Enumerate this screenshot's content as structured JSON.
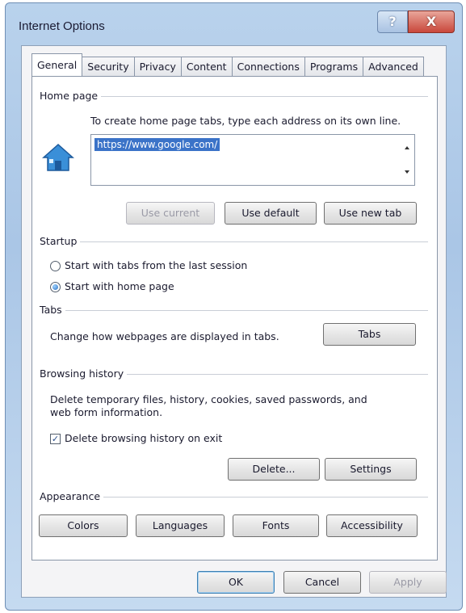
{
  "window": {
    "title": "Internet Options",
    "help_glyph": "?",
    "close_glyph": "X"
  },
  "tabs": [
    "General",
    "Security",
    "Privacy",
    "Content",
    "Connections",
    "Programs",
    "Advanced"
  ],
  "home_page": {
    "group_label": "Home page",
    "instruction": "To create home page tabs, type each address on its own line.",
    "address_value": "https://www.google.com/",
    "buttons": {
      "use_current": "Use current",
      "use_default": "Use default",
      "use_new_tab": "Use new tab"
    }
  },
  "startup": {
    "group_label": "Startup",
    "options": [
      {
        "label": "Start with tabs from the last session",
        "checked": false
      },
      {
        "label": "Start with home page",
        "checked": true
      }
    ]
  },
  "tabs_group": {
    "group_label": "Tabs",
    "description": "Change how webpages are displayed in tabs.",
    "button": "Tabs"
  },
  "browsing_history": {
    "group_label": "Browsing history",
    "description_line1": "Delete temporary files, history, cookies, saved passwords, and",
    "description_line2": "web form information.",
    "checkbox_label": "Delete browsing history on exit",
    "checkbox_checked": true,
    "buttons": {
      "delete": "Delete...",
      "settings": "Settings"
    }
  },
  "appearance": {
    "group_label": "Appearance",
    "buttons": {
      "colors": "Colors",
      "languages": "Languages",
      "fonts": "Fonts",
      "accessibility": "Accessibility"
    }
  },
  "footer": {
    "ok": "OK",
    "cancel": "Cancel",
    "apply": "Apply"
  }
}
